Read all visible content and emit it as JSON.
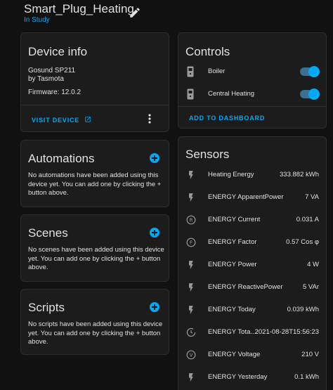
{
  "header": {
    "title": "Smart_Plug_Heating",
    "area": "In Study"
  },
  "device_info": {
    "title": "Device info",
    "model": "Gosund SP211",
    "manufacturer": "by Tasmota",
    "firmware": "Firmware: 12.0.2",
    "visit_label": "VISIT DEVICE"
  },
  "automations": {
    "title": "Automations",
    "empty_text_1": "No automations have been added using this",
    "empty_text_2": "device yet. You can add one by clicking the +",
    "empty_text_3": "button above."
  },
  "scenes": {
    "title": "Scenes",
    "empty_text_1": "No scenes have been added using this device",
    "empty_text_2": "yet. You can add one by clicking the + button",
    "empty_text_3": "above."
  },
  "scripts": {
    "title": "Scripts",
    "empty_text_1": "No scripts have been added using this device",
    "empty_text_2": "yet. You can add one by clicking the + button",
    "empty_text_3": "above."
  },
  "controls": {
    "title": "Controls",
    "items": [
      {
        "label": "Boiler",
        "state": "on"
      },
      {
        "label": "Central Heating",
        "state": "on"
      }
    ],
    "add_label": "ADD TO DASHBOARD"
  },
  "sensors": {
    "title": "Sensors",
    "items": [
      {
        "icon": "flash-icon",
        "label": "Heating Energy",
        "value": "333.882 kWh"
      },
      {
        "icon": "flash-icon",
        "label": "ENERGY ApparentPower",
        "value": "7 VA"
      },
      {
        "icon": "r-circle-icon",
        "label": "ENERGY Current",
        "value": "0.031 A"
      },
      {
        "icon": "f-circle-icon",
        "label": "ENERGY Factor",
        "value": "0.57 Cos φ"
      },
      {
        "icon": "flash-icon",
        "label": "ENERGY Power",
        "value": "4 W"
      },
      {
        "icon": "flash-icon",
        "label": "ENERGY ReactivePower",
        "value": "5 VAr"
      },
      {
        "icon": "flash-icon",
        "label": "ENERGY Today",
        "value": "0.039 kWh"
      },
      {
        "icon": "clock-icon",
        "label": "ENERGY Tota...",
        "value": "2021-08-28T15:56:23"
      },
      {
        "icon": "v-circle-icon",
        "label": "ENERGY Voltage",
        "value": "210 V"
      },
      {
        "icon": "flash-icon",
        "label": "ENERGY Yesterday",
        "value": "0.1 kWh"
      }
    ]
  },
  "colors": {
    "accent": "#03a9f4",
    "card": "#1c1c1c",
    "background": "#111111"
  }
}
